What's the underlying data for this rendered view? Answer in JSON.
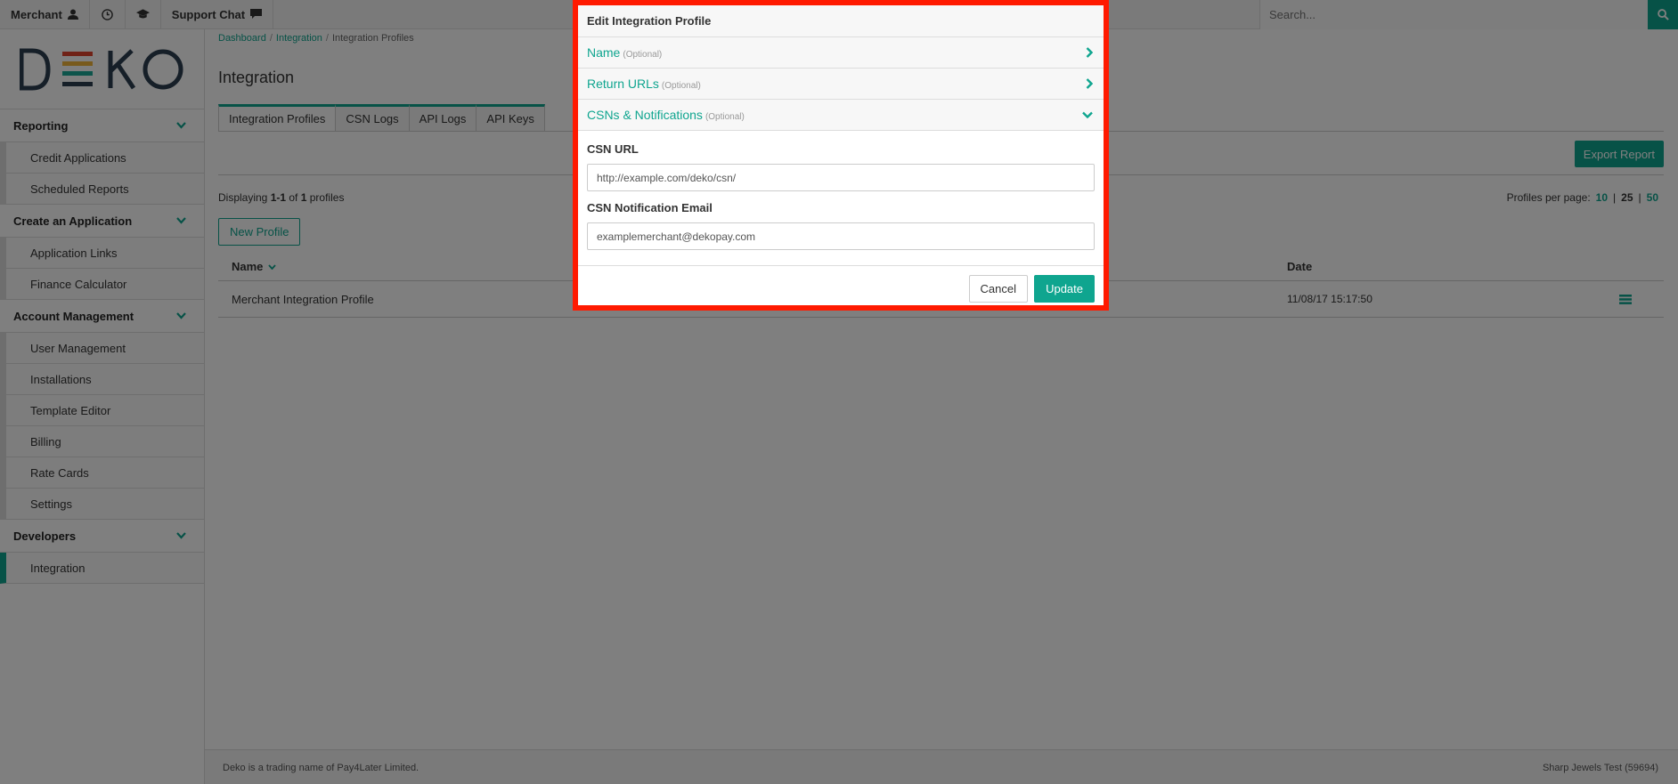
{
  "topbar": {
    "merchant_label": "Merchant",
    "support_chat_label": "Support Chat",
    "search_placeholder": "Search..."
  },
  "sidebar": {
    "logo_text": "DEKO",
    "sections": [
      {
        "label": "Reporting",
        "items": [
          "Credit Applications",
          "Scheduled Reports"
        ]
      },
      {
        "label": "Create an Application",
        "items": [
          "Application Links",
          "Finance Calculator"
        ]
      },
      {
        "label": "Account Management",
        "items": [
          "User Management",
          "Installations",
          "Template Editor",
          "Billing",
          "Rate Cards",
          "Settings"
        ]
      },
      {
        "label": "Developers",
        "items": [
          "Integration"
        ]
      }
    ]
  },
  "breadcrumb": {
    "items": [
      "Dashboard",
      "Integration",
      "Integration Profiles"
    ]
  },
  "page": {
    "title": "Integration",
    "tabs": [
      "Integration Profiles",
      "CSN Logs",
      "API Logs",
      "API Keys"
    ],
    "export_label": "Export Report",
    "displaying": {
      "prefix": "Displaying ",
      "range": "1-1",
      "of": " of ",
      "total": "1",
      "suffix": " profiles"
    },
    "per_page": {
      "label": "Profiles per page:",
      "options": [
        "10",
        "25",
        "50"
      ],
      "sep": "|"
    },
    "new_profile_label": "New Profile"
  },
  "table": {
    "headers": {
      "name": "Name",
      "date": "Date"
    },
    "rows": [
      {
        "name": "Merchant Integration Profile",
        "date": "11/08/17 15:17:50"
      }
    ]
  },
  "footer": {
    "left": "Deko is a trading name of Pay4Later Limited.",
    "right": "Sharp Jewels Test (59694)"
  },
  "modal": {
    "title": "Edit Integration Profile",
    "sections": [
      {
        "title": "Name",
        "optional": "(Optional)"
      },
      {
        "title": "Return URLs",
        "optional": "(Optional)"
      },
      {
        "title": "CSNs & Notifications",
        "optional": "(Optional)"
      }
    ],
    "fields": {
      "csn_url_label": "CSN URL",
      "csn_url_value": "http://example.com/deko/csn/",
      "csn_email_label": "CSN Notification Email",
      "csn_email_value": "examplemerchant@dekopay.com"
    },
    "cancel_label": "Cancel",
    "update_label": "Update"
  },
  "colors": {
    "accent": "#0fa58f",
    "highlight_border": "#ff1a00"
  }
}
